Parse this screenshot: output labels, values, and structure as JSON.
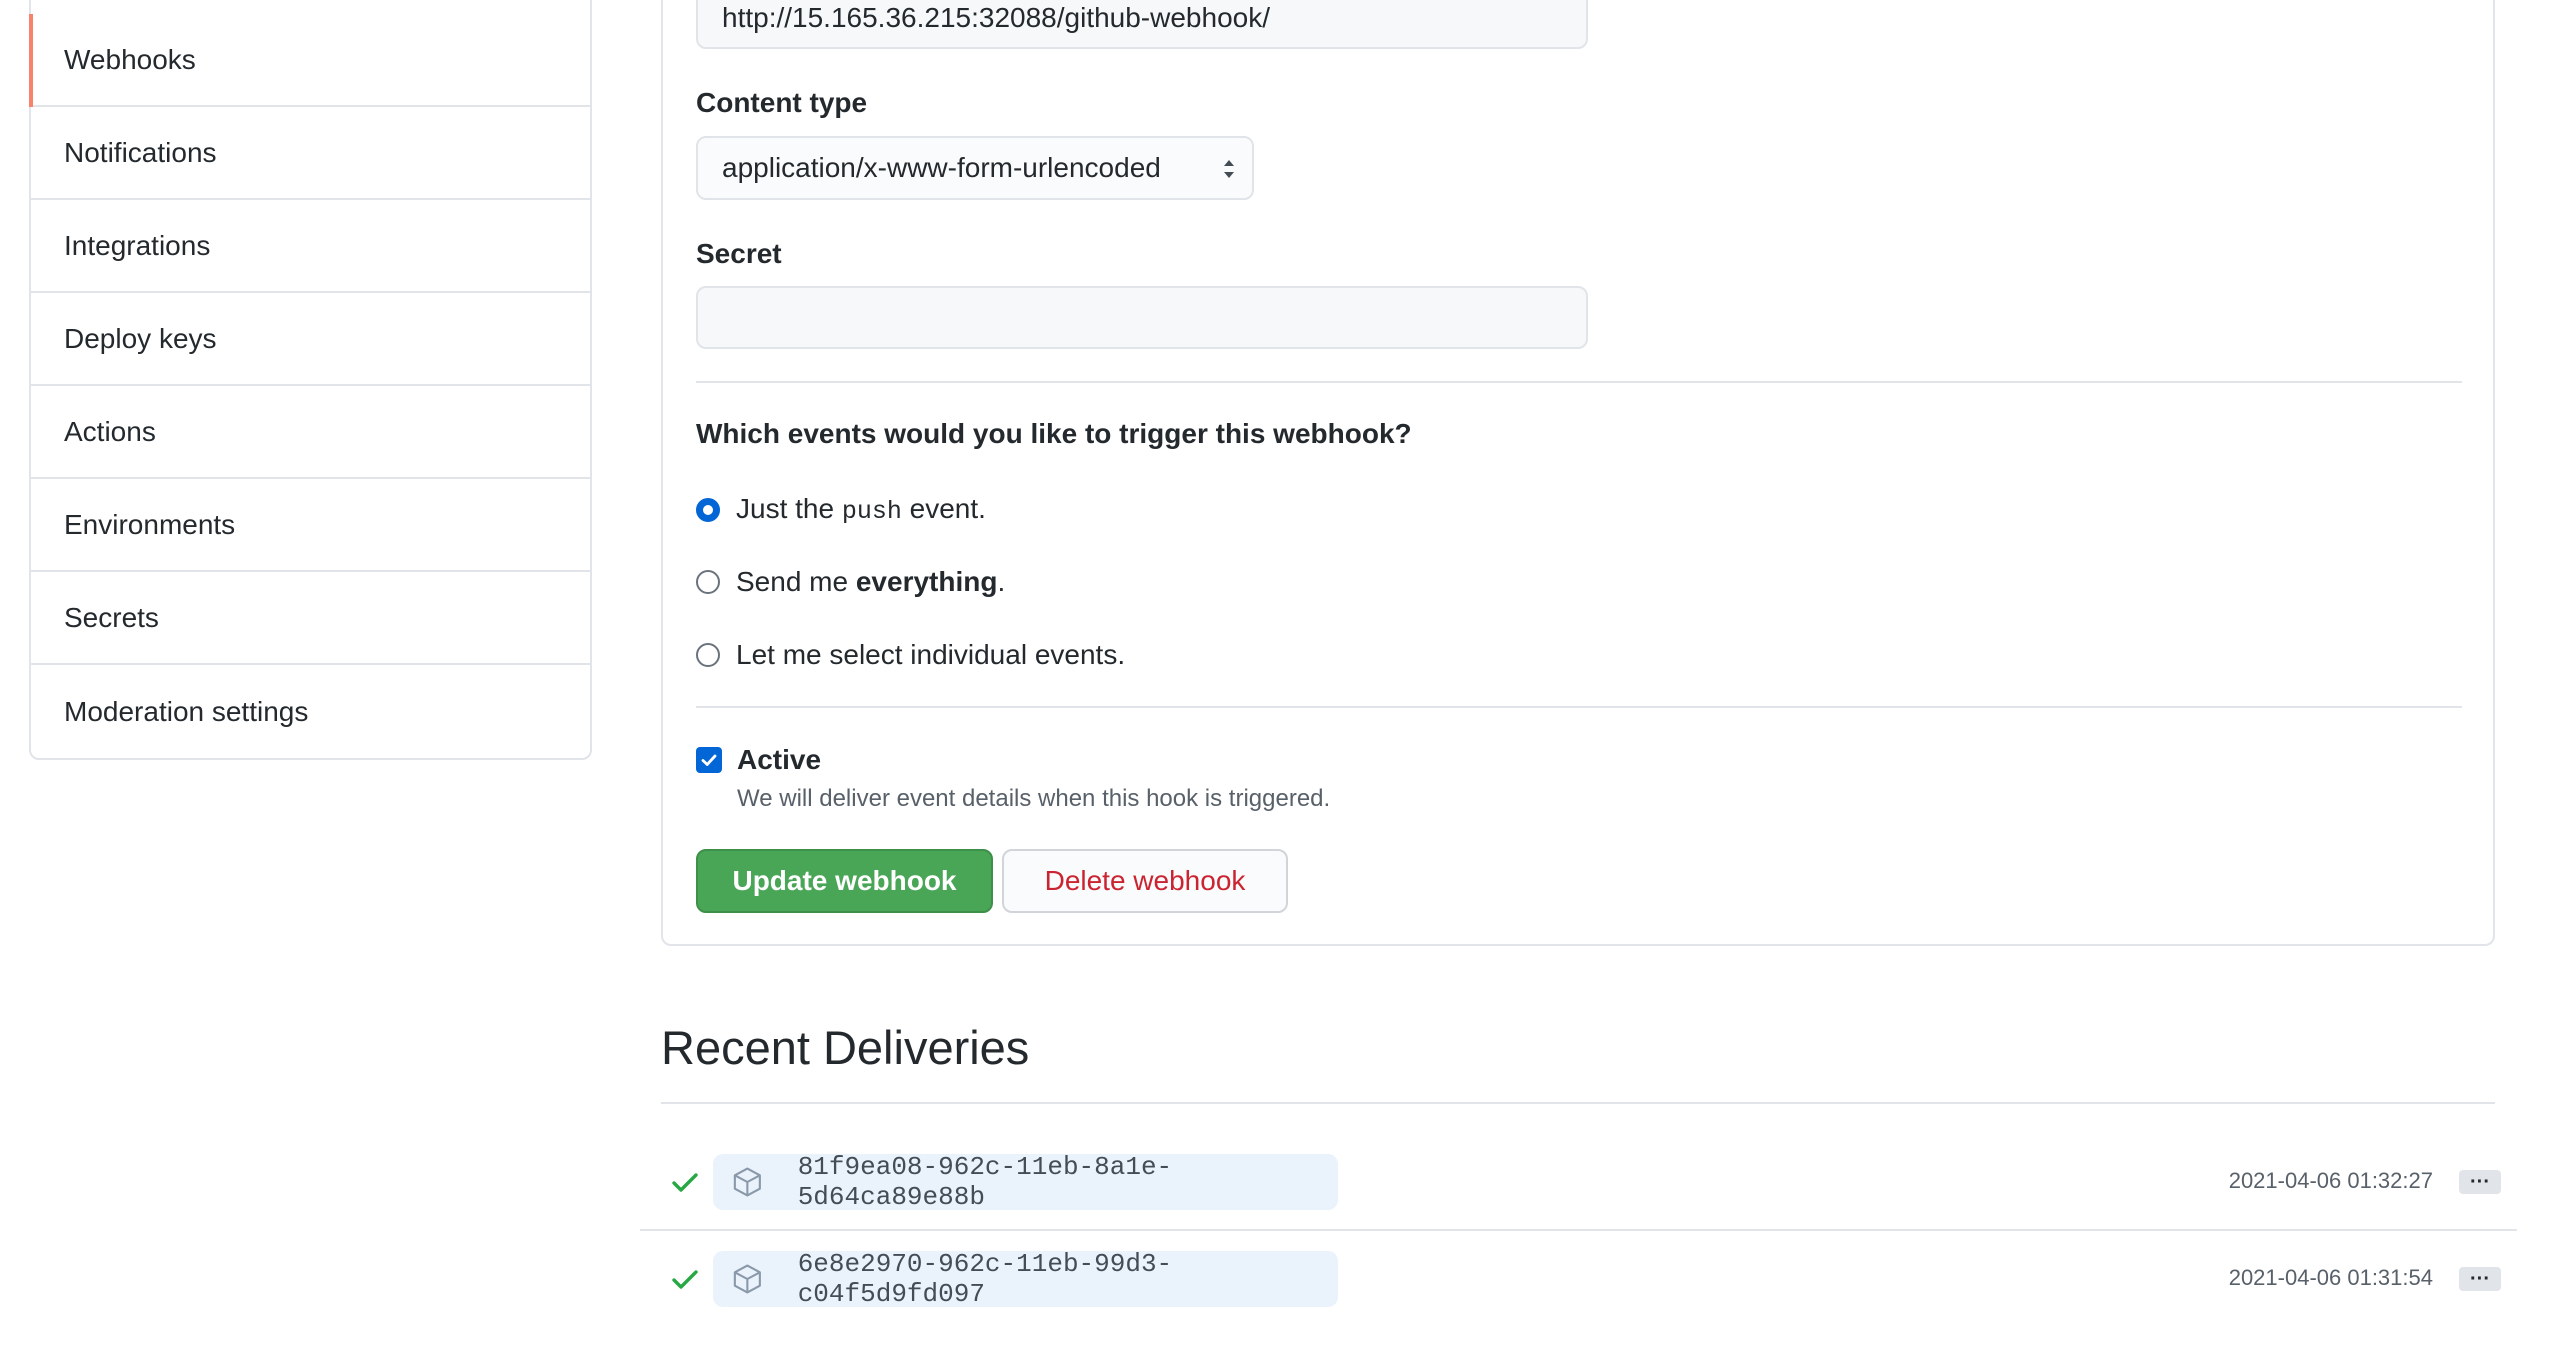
{
  "sidebar": {
    "items": [
      {
        "label": "Webhooks",
        "selected": true
      },
      {
        "label": "Notifications"
      },
      {
        "label": "Integrations"
      },
      {
        "label": "Deploy keys"
      },
      {
        "label": "Actions"
      },
      {
        "label": "Environments"
      },
      {
        "label": "Secrets"
      },
      {
        "label": "Moderation settings"
      }
    ]
  },
  "form": {
    "payload_url_value": "http://15.165.36.215:32088/github-webhook/",
    "content_type_label": "Content type",
    "content_type_value": "application/x-www-form-urlencoded",
    "secret_label": "Secret",
    "secret_value": "",
    "events_question": "Which events would you like to trigger this webhook?",
    "events": {
      "push_prefix": "Just the ",
      "push_code": "push",
      "push_suffix": " event.",
      "everything_prefix": "Send me ",
      "everything_bold": "everything",
      "everything_suffix": ".",
      "individual": "Let me select individual events.",
      "selected": "push"
    },
    "active_label": "Active",
    "active_checked": true,
    "active_note": "We will deliver event details when this hook is triggered.",
    "update_button": "Update webhook",
    "delete_button": "Delete webhook"
  },
  "recent": {
    "title": "Recent Deliveries",
    "deliveries": [
      {
        "guid": "81f9ea08-962c-11eb-8a1e-5d64ca89e88b",
        "time": "2021-04-06 01:32:27",
        "status": "success",
        "more": "···"
      },
      {
        "guid": "6e8e2970-962c-11eb-99d3-c04f5d9fd097",
        "time": "2021-04-06 01:31:54",
        "status": "success",
        "more": "···"
      }
    ]
  },
  "colors": {
    "accent": "#0366d6",
    "success": "#28a745",
    "danger": "#cb2431",
    "selected_marker": "#f9826c"
  },
  "icons": [
    "check-icon",
    "package-icon",
    "select-caret-icon",
    "checkbox-check-icon"
  ]
}
